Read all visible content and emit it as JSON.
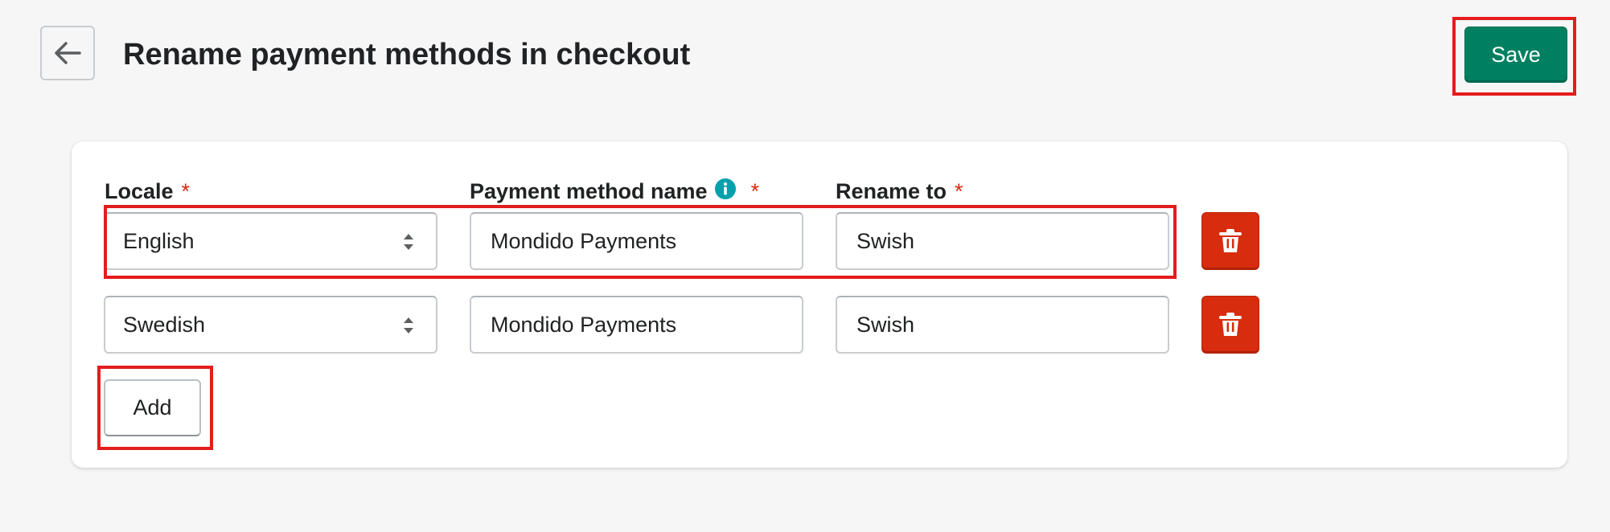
{
  "header": {
    "title": "Rename payment methods in checkout",
    "back_icon": "arrow-left-icon",
    "save_label": "Save"
  },
  "form": {
    "columns": {
      "locale": "Locale",
      "payment_method_name": "Payment method name",
      "rename_to": "Rename to",
      "required_marker": "*"
    },
    "rows": [
      {
        "locale": "English",
        "payment_method_name": "Mondido Payments",
        "rename_to": "Swish"
      },
      {
        "locale": "Swedish",
        "payment_method_name": "Mondido Payments",
        "rename_to": "Swish"
      }
    ],
    "add_label": "Add"
  },
  "colors": {
    "primary": "#008060",
    "critical": "#d72c0d",
    "info": "#00a0ac",
    "highlight": "#e31d1d",
    "background": "#f6f6f7"
  }
}
